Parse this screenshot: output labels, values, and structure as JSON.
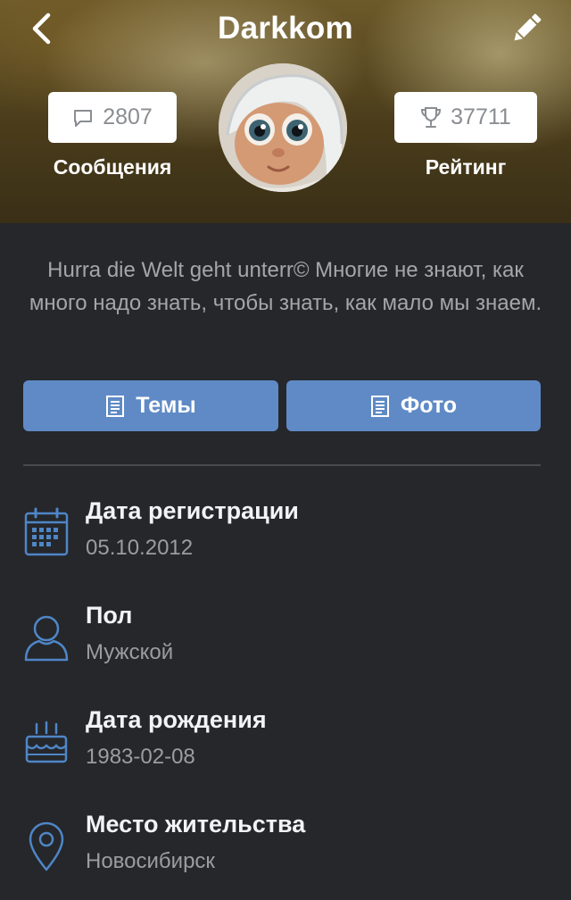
{
  "header": {
    "title": "Darkkom",
    "messages": {
      "count": "2807",
      "label": "Сообщения"
    },
    "rating": {
      "count": "37711",
      "label": "Рейтинг"
    }
  },
  "bio": "Hurra die Welt geht unterr©  Многие не знают, как много надо знать, чтобы знать, как мало мы знаем.",
  "buttons": {
    "topics": "Темы",
    "photo": "Фото"
  },
  "details": [
    {
      "label": "Дата регистрации",
      "value": "05.10.2012",
      "icon": "calendar-icon"
    },
    {
      "label": "Пол",
      "value": "Мужской",
      "icon": "user-icon"
    },
    {
      "label": "Дата рождения",
      "value": "1983-02-08",
      "icon": "cake-icon"
    },
    {
      "label": "Место жительства",
      "value": "Новосибирск",
      "icon": "location-pin-icon"
    }
  ],
  "colors": {
    "accent": "#5f8ac6",
    "background": "#25272b",
    "icon": "#4f86c6"
  }
}
